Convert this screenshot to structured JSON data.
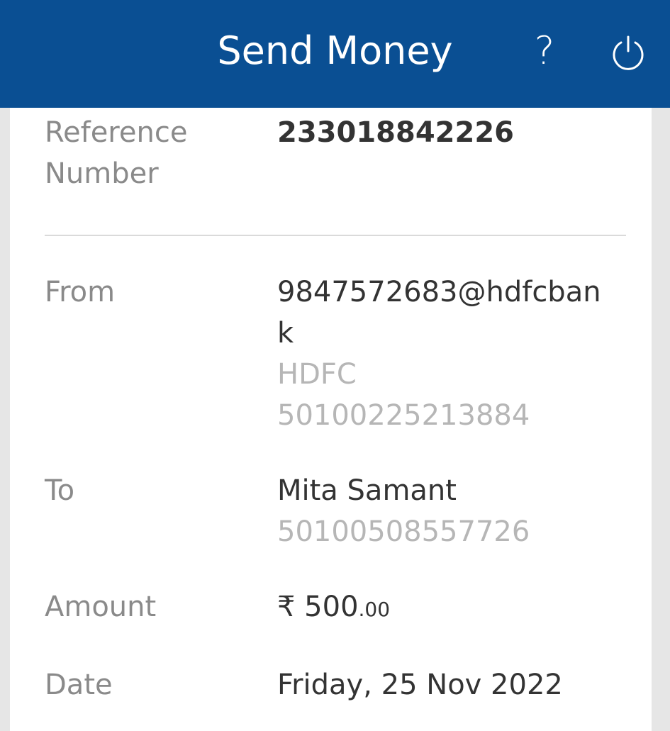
{
  "header": {
    "title": "Send Money",
    "help_label": "?",
    "power_icon": "power-icon",
    "background_color": "#0a4f93"
  },
  "details": {
    "reference": {
      "label_line1": "Reference",
      "label_line2": "Number",
      "value": "233018842226"
    },
    "from": {
      "label": "From",
      "vpa_line1": "9847572683@hdfcban",
      "vpa_line2": "k",
      "bank": "HDFC",
      "account": "50100225213884"
    },
    "to": {
      "label": "To",
      "name": "Mita Samant",
      "account": "50100508557726"
    },
    "amount": {
      "label": "Amount",
      "currency": "₹",
      "whole": "500",
      "decimal": ".00"
    },
    "date": {
      "label": "Date",
      "value": "Friday, 25 Nov 2022"
    }
  }
}
